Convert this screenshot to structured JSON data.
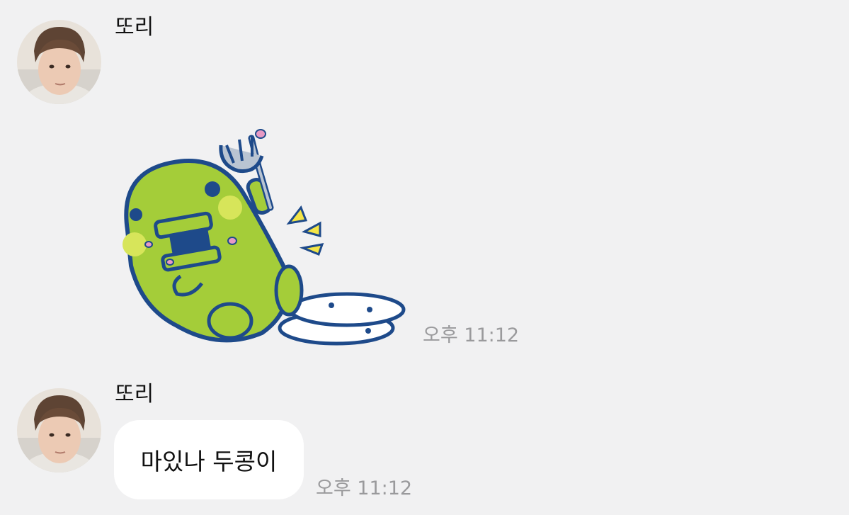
{
  "chat": {
    "messages": [
      {
        "sender": "또리",
        "avatar_icon": "profile-photo",
        "type": "sticker",
        "sticker_icon": "green-character-fork-plates-sticker",
        "time": "오후 11:12"
      },
      {
        "sender": "또리",
        "avatar_icon": "profile-photo",
        "type": "text",
        "text": "마있나 두콩이",
        "time": "오후 11:12"
      }
    ]
  },
  "colors": {
    "background": "#f1f1f2",
    "bubble": "#ffffff",
    "timestamp": "#9a9a9c",
    "sticker_body": "#a4cd39",
    "sticker_outline": "#1e4a8a"
  }
}
